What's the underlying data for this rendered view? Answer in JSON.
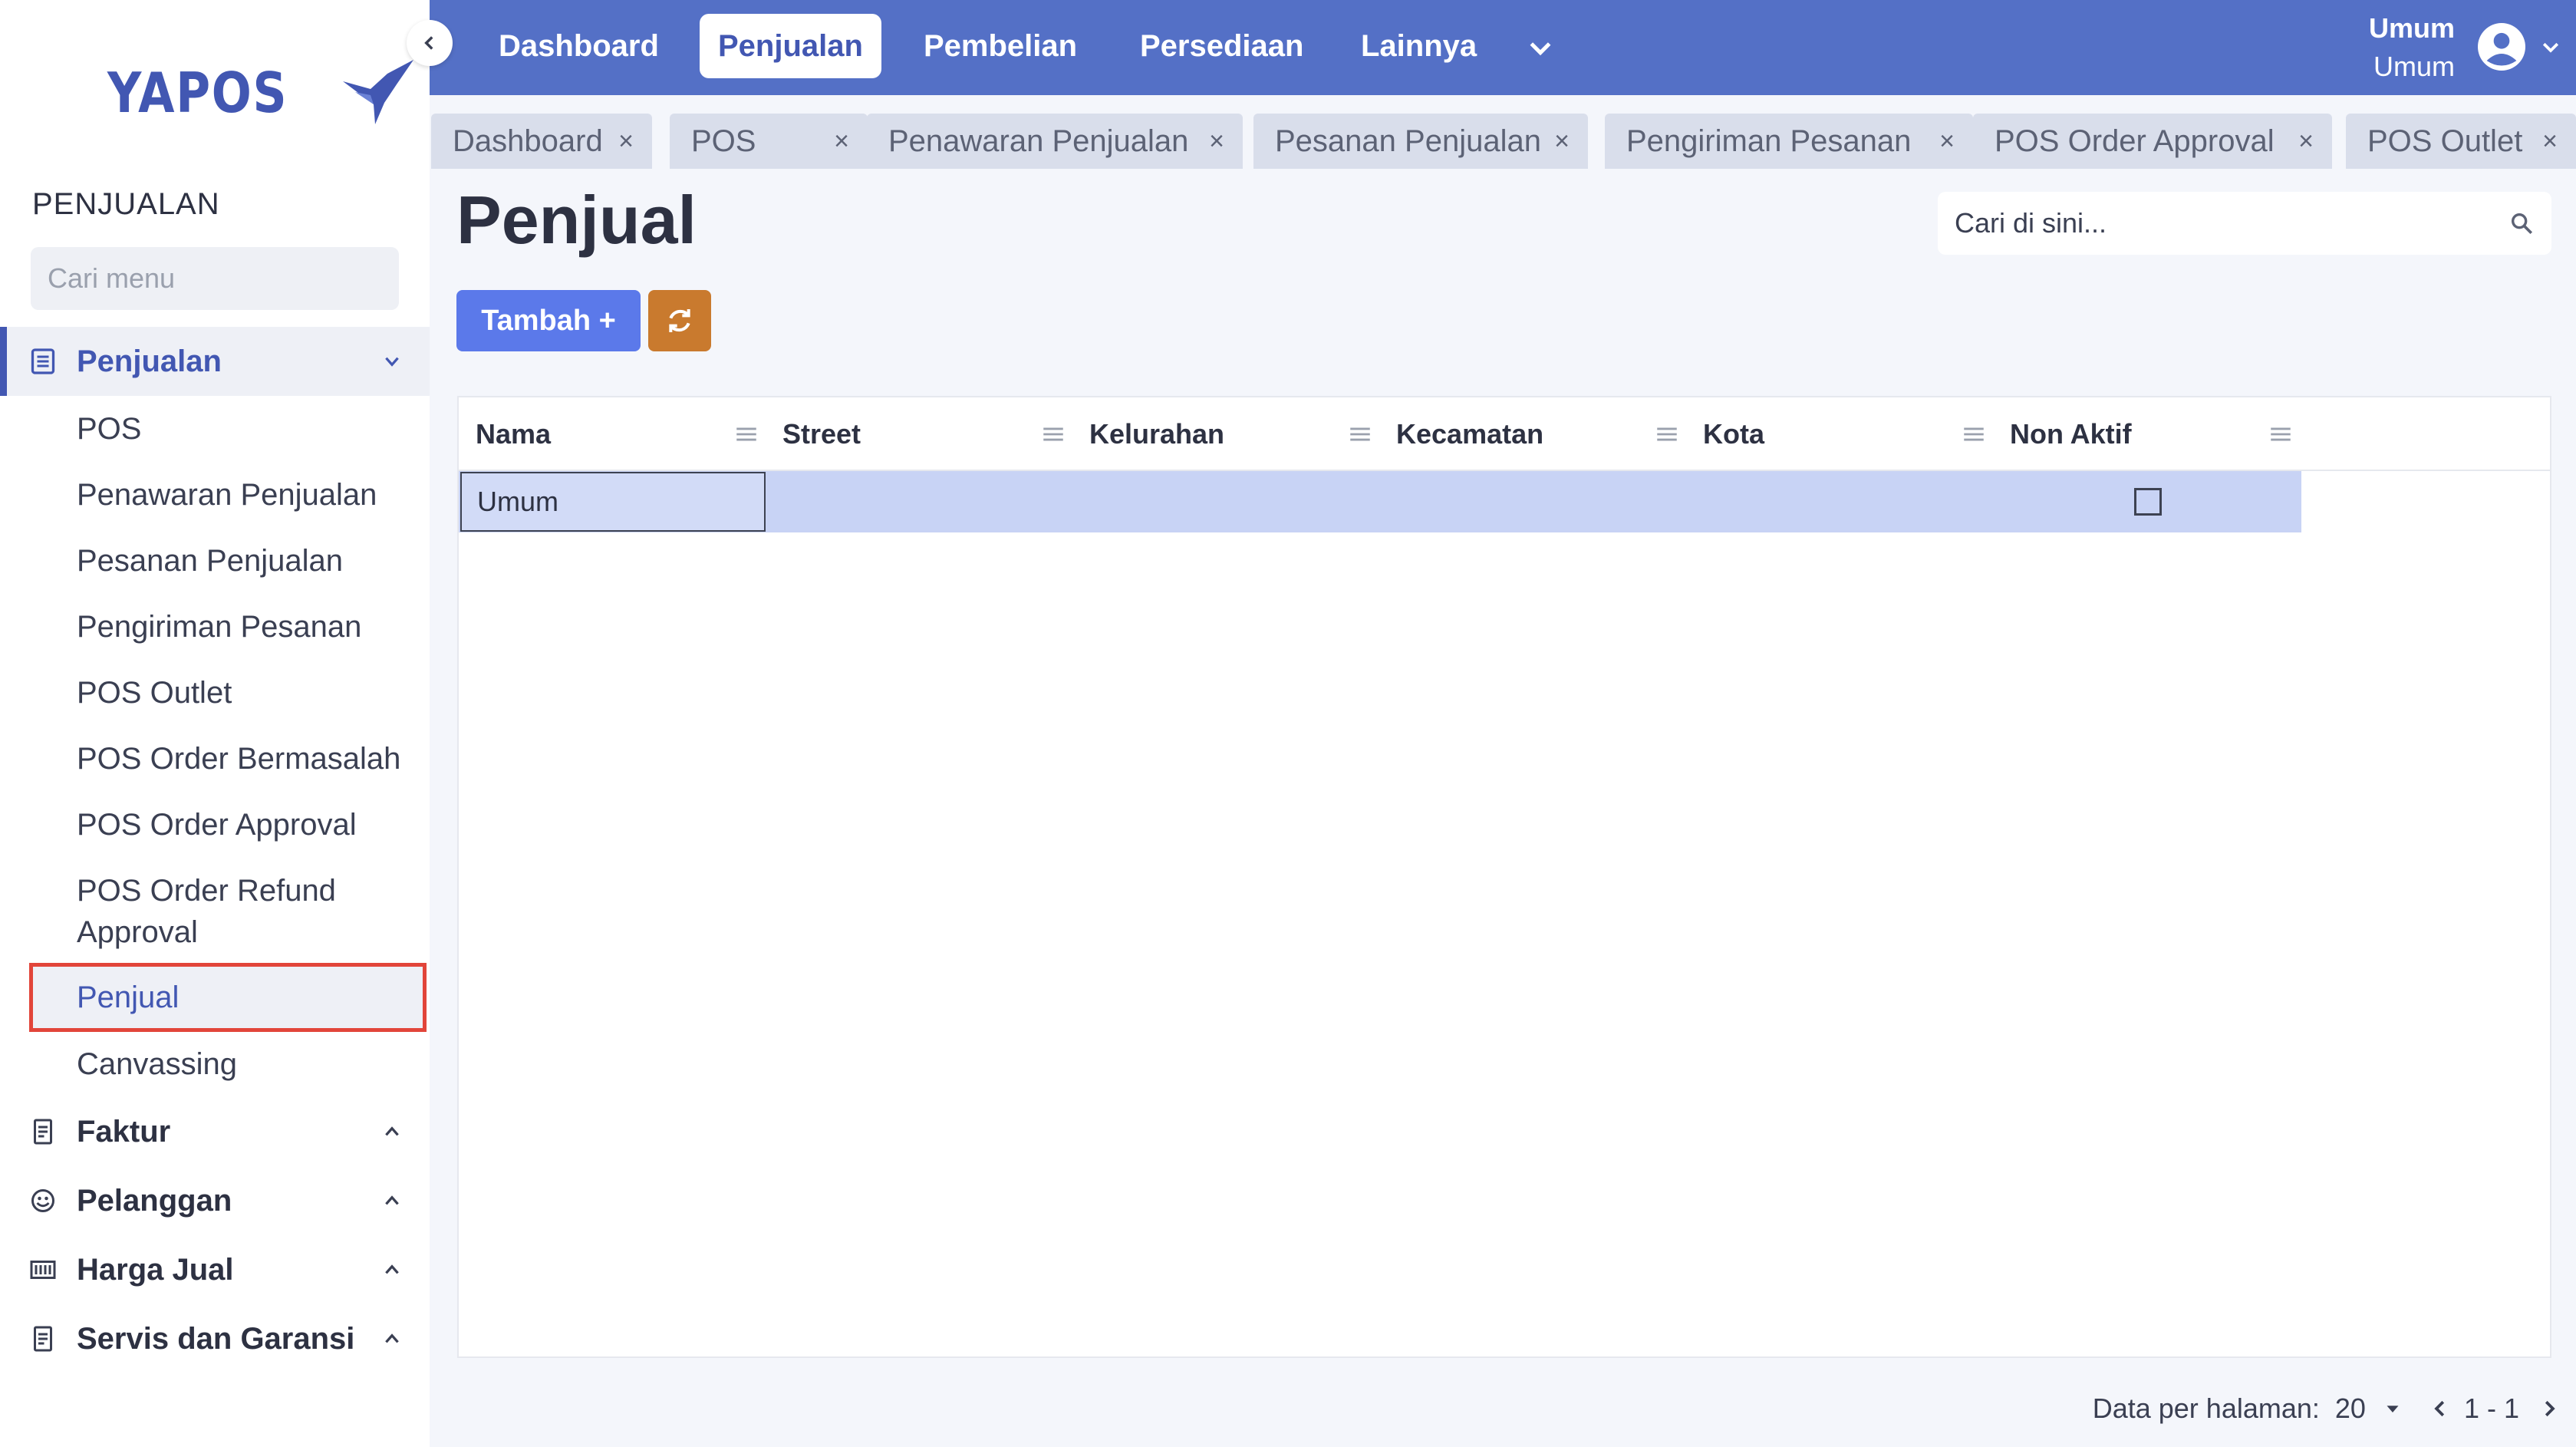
{
  "brand": {
    "logo_text": "YAPOS"
  },
  "sidebar": {
    "section_title": "PENJUALAN",
    "search_placeholder": "Cari menu",
    "groups": [
      {
        "label": "Penjualan",
        "icon": "list-icon",
        "expanded": true
      },
      {
        "label": "Faktur",
        "icon": "receipt-icon",
        "expanded": false
      },
      {
        "label": "Pelanggan",
        "icon": "customer-icon",
        "expanded": false
      },
      {
        "label": "Harga Jual",
        "icon": "barcode-icon",
        "expanded": false
      },
      {
        "label": "Servis dan Garansi",
        "icon": "receipt-icon",
        "expanded": false
      }
    ],
    "sub_items": [
      "POS",
      "Penawaran Penjualan",
      "Pesanan Penjualan",
      "Pengiriman Pesanan",
      "POS Outlet",
      "POS Order Bermasalah",
      "POS Order Approval",
      "POS Order Refund Approval",
      "Penjual",
      "Canvassing"
    ],
    "selected_item": "Penjual"
  },
  "topnav": {
    "items": [
      "Dashboard",
      "Penjualan",
      "Pembelian",
      "Persediaan",
      "Lainnya"
    ],
    "active": "Penjualan",
    "user": {
      "line1": "Umum",
      "line2": "Umum"
    }
  },
  "tabs": [
    "Dashboard",
    "POS",
    "Penawaran Penjualan",
    "Pesanan Penjualan",
    "Pengiriman Pesanan",
    "POS Order Approval",
    "POS Outlet"
  ],
  "main": {
    "title": "Penjual",
    "search_placeholder": "Cari di sini...",
    "add_button": "Tambah +",
    "columns": [
      "Nama",
      "Street",
      "Kelurahan",
      "Kecamatan",
      "Kota",
      "Non Aktif"
    ],
    "rows": [
      {
        "nama": "Umum",
        "street": "",
        "kelurahan": "",
        "kecamatan": "",
        "kota": "",
        "non_aktif": false
      }
    ],
    "footer": {
      "per_page_label": "Data per halaman:",
      "per_page": "20",
      "range": "1 - 1"
    }
  },
  "colors": {
    "primary": "#5470c6",
    "accent": "#4257b2",
    "add_button": "#5b79ea",
    "refresh_button": "#c97a2e",
    "selected_row": "#c8d3f5",
    "highlight_border": "#e2453a"
  }
}
